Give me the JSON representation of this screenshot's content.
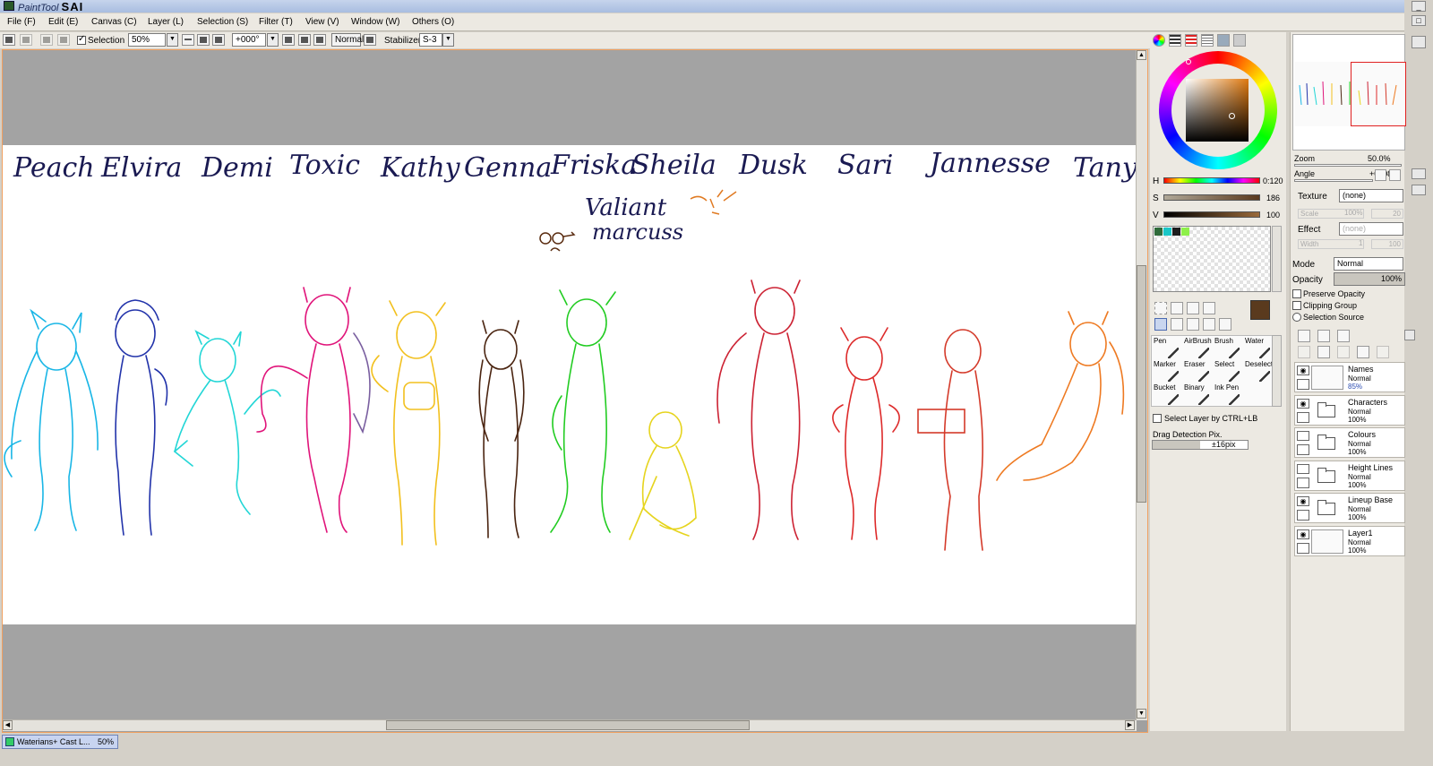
{
  "app": {
    "title_prefix": "PaintTool",
    "title_name": "SAI"
  },
  "window_controls": {
    "minimize": "_",
    "maximize": "□"
  },
  "menu": [
    "File (F)",
    "Edit (E)",
    "Canvas (C)",
    "Layer (L)",
    "Selection (S)",
    "Filter (T)",
    "View (V)",
    "Window (W)",
    "Others (O)"
  ],
  "toolbar": {
    "selection_label": "Selection",
    "zoom_value": "50%",
    "angle_value": "+000°",
    "blend_mode": "Normal",
    "stabilizer_label": "Stabilizer",
    "stabilizer_value": "S-3"
  },
  "canvas": {
    "names_row": [
      "Peach",
      "Elvira",
      "Demi",
      "Toxic",
      "Kathy",
      "Genna",
      "Friska",
      "Sheila",
      "Dusk",
      "Sari",
      "Jannesse",
      "Tanya"
    ],
    "names_row2": [
      "Valiant",
      "marcuss"
    ]
  },
  "document_tab": {
    "name": "Waterians+ Cast L...",
    "zoom": "50%"
  },
  "color_panel": {
    "h_label": "H",
    "h_value": "0:120",
    "s_label": "S",
    "s_value": "186",
    "v_label": "V",
    "v_value": "100",
    "primary_color": "#5a3a1e",
    "secondary_color": "#c8bc9a",
    "swatches": [
      "#2f6b3a",
      "#19c7c7",
      "#1d1d1d",
      "#8ef04a"
    ]
  },
  "tools": [
    {
      "label": "Pen"
    },
    {
      "label": "AirBrush"
    },
    {
      "label": "Brush"
    },
    {
      "label": "Water"
    },
    {
      "label": "Marker"
    },
    {
      "label": "Eraser"
    },
    {
      "label": "Select"
    },
    {
      "label": "Deselect"
    },
    {
      "label": "Bucket"
    },
    {
      "label": "Binary"
    },
    {
      "label": "Ink Pen"
    },
    {
      "label": ""
    }
  ],
  "select_layer_label": "Select Layer by CTRL+LB",
  "drag_detection": {
    "label": "Drag Detection Pix.",
    "value": "±16pix"
  },
  "navigator": {
    "zoom_label": "Zoom",
    "zoom_value": "50.0%",
    "angle_label": "Angle",
    "angle_value": "+0008"
  },
  "texture": {
    "label": "Texture",
    "value": "(none)",
    "scale_label": "Scale",
    "scale_value": "100%",
    "scale_extra": "20"
  },
  "effect": {
    "label": "Effect",
    "value": "(none)",
    "width_label": "Width",
    "width_value": "1",
    "width_extra": "100"
  },
  "layer_props": {
    "mode_label": "Mode",
    "mode_value": "Normal",
    "opacity_label": "Opacity",
    "opacity_value": "100%",
    "preserve_opacity": "Preserve Opacity",
    "clipping_group": "Clipping Group",
    "selection_source": "Selection Source"
  },
  "layers": [
    {
      "name": "Names",
      "mode": "Normal",
      "opacity": "85%",
      "type": "layer",
      "visible": true
    },
    {
      "name": "Characters",
      "mode": "Normal",
      "opacity": "100%",
      "type": "folder",
      "visible": true
    },
    {
      "name": "Colours",
      "mode": "Normal",
      "opacity": "100%",
      "type": "folder",
      "visible": false
    },
    {
      "name": "Height Lines",
      "mode": "Normal",
      "opacity": "100%",
      "type": "folder",
      "visible": false
    },
    {
      "name": "Lineup Base",
      "mode": "Normal",
      "opacity": "100%",
      "type": "folder",
      "visible": true
    },
    {
      "name": "Layer1",
      "mode": "Normal",
      "opacity": "100%",
      "type": "layer",
      "visible": true
    }
  ]
}
